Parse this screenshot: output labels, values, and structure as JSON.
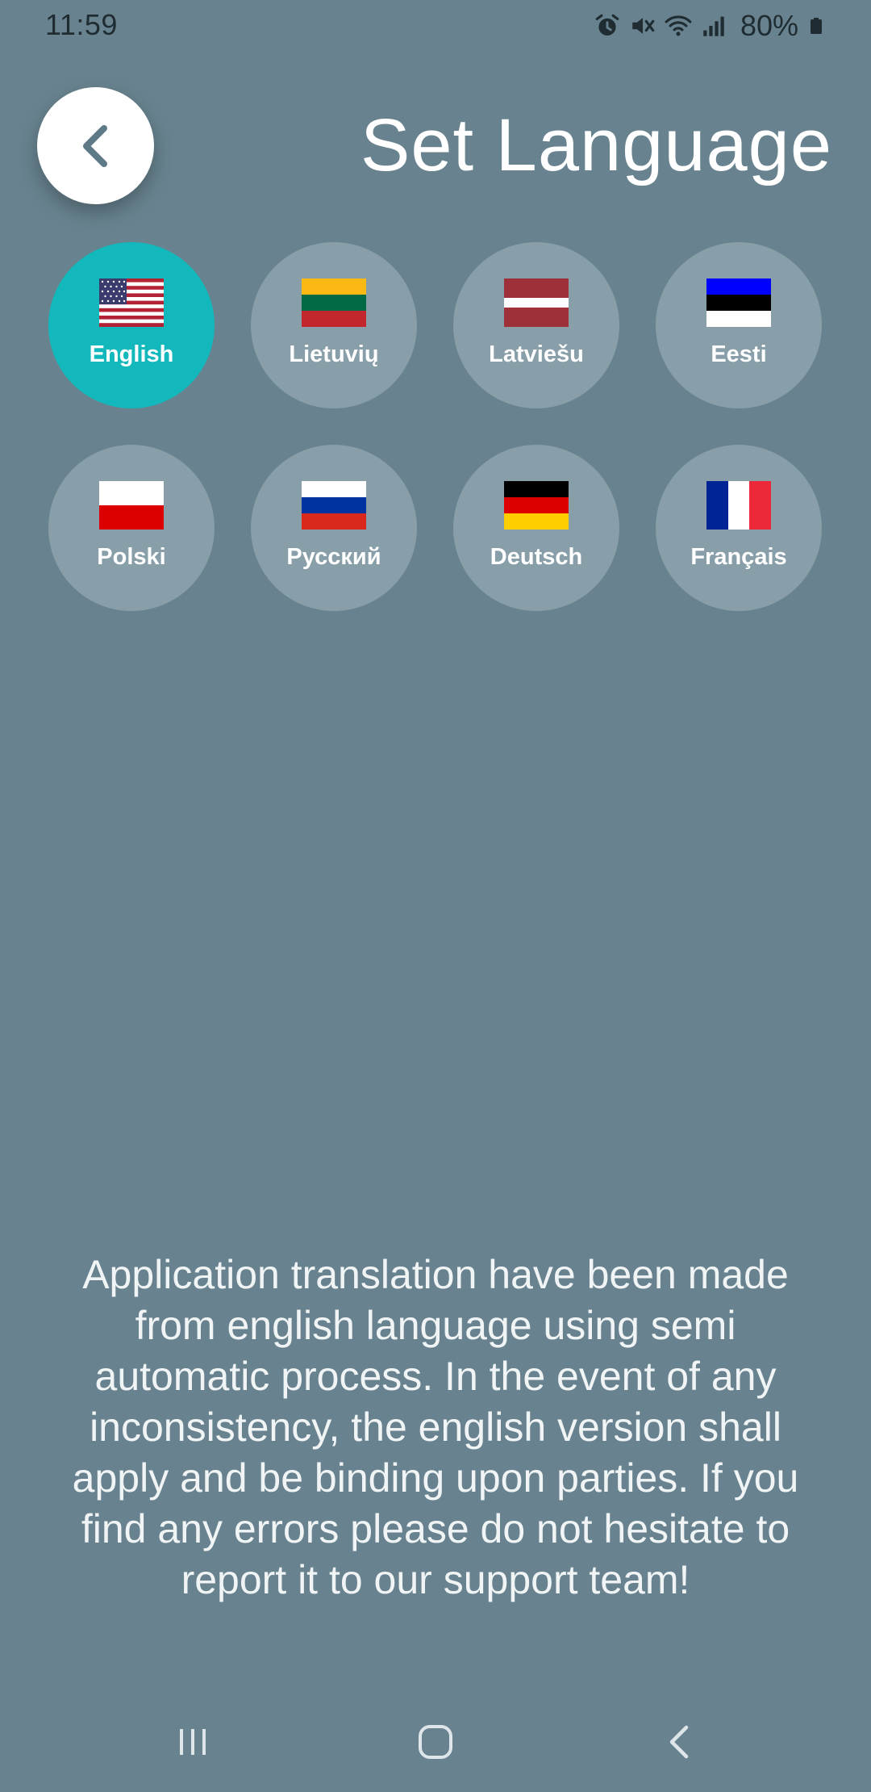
{
  "status_bar": {
    "time": "11:59",
    "battery_percent": "80%",
    "icons": [
      "alarm-icon",
      "mute-icon",
      "wifi-icon",
      "signal-icon",
      "battery-icon"
    ]
  },
  "header": {
    "back_icon": "chevron-left-icon",
    "title": "Set Language"
  },
  "languages": [
    {
      "label": "English",
      "flag": "us-flag-icon",
      "selected": true
    },
    {
      "label": "Lietuvių",
      "flag": "lt-flag-icon",
      "selected": false
    },
    {
      "label": "Latviešu",
      "flag": "lv-flag-icon",
      "selected": false
    },
    {
      "label": "Eesti",
      "flag": "ee-flag-icon",
      "selected": false
    },
    {
      "label": "Polski",
      "flag": "pl-flag-icon",
      "selected": false
    },
    {
      "label": "Русский",
      "flag": "ru-flag-icon",
      "selected": false
    },
    {
      "label": "Deutsch",
      "flag": "de-flag-icon",
      "selected": false
    },
    {
      "label": "Français",
      "flag": "fr-flag-icon",
      "selected": false
    }
  ],
  "disclaimer": "Application translation have been made from english language using semi automatic process. In the event of any inconsistency, the english version shall apply and be binding upon parties. If you find any errors please do not hesitate to report it to our support team!",
  "colors": {
    "background": "#68838f",
    "tile": "#889ea8",
    "selected_tile": "#12b8bb",
    "back_button": "#ffffff"
  },
  "nav_bar": {
    "icons": [
      "recents-icon",
      "home-icon",
      "back-icon"
    ]
  }
}
